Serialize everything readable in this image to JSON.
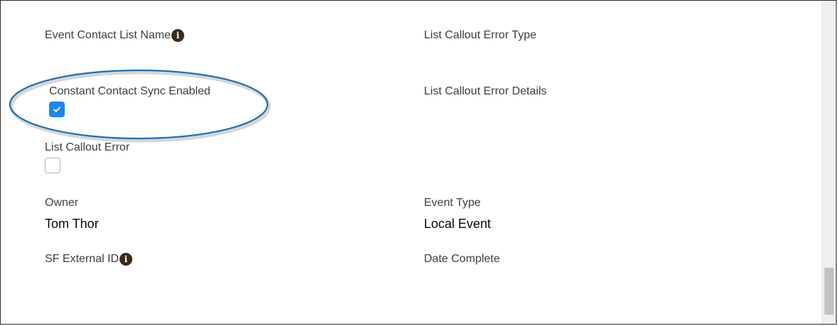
{
  "fields": {
    "event_contact_list_name": {
      "label": "Event Contact List Name",
      "info_icon": "info-icon"
    },
    "list_callout_error_type": {
      "label": "List Callout Error Type"
    },
    "constant_contact_sync_enabled": {
      "label": "Constant Contact Sync Enabled",
      "checked": true
    },
    "list_callout_error_details": {
      "label": "List Callout Error Details"
    },
    "list_callout_error": {
      "label": "List Callout Error",
      "checked": false
    },
    "owner": {
      "label": "Owner",
      "value": "Tom Thor"
    },
    "event_type": {
      "label": "Event Type",
      "value": "Local Event"
    },
    "sf_external_id": {
      "label": "SF External ID",
      "info_icon": "info-icon"
    },
    "date_complete": {
      "label": "Date Complete"
    }
  },
  "colors": {
    "checkbox_checked": "#1b86f0",
    "highlight_ellipse": "#1f6fb2",
    "info_icon": "#3b2b19"
  }
}
